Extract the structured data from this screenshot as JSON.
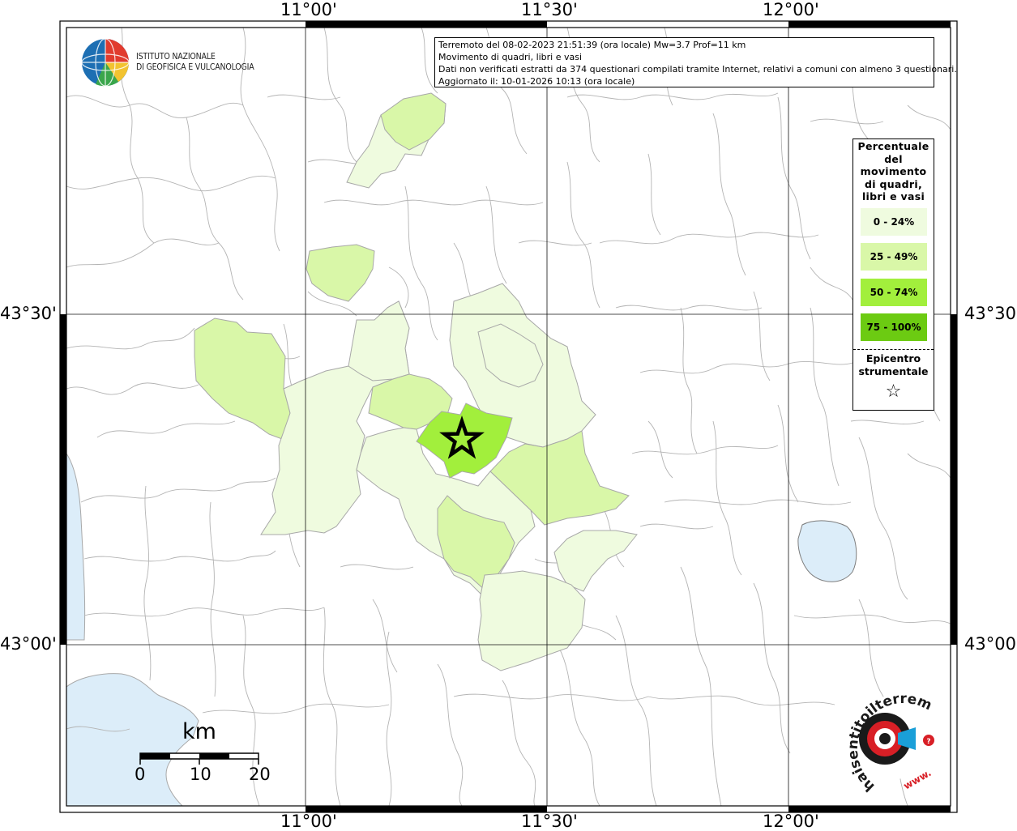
{
  "map": {
    "lon_labels": [
      "11°00'",
      "11°30'",
      "12°00'"
    ],
    "lat_labels": [
      "43°30'",
      "43°00'"
    ]
  },
  "logo": {
    "institute_line1": "ISTITUTO NAZIONALE",
    "institute_line2": "DI GEOFISICA E VULCANOLOGIA"
  },
  "info": {
    "line1": "Terremoto del 08-02-2023 21:51:39 (ora locale) Mw=3.7 Prof=11 km",
    "line2": "Movimento di quadri, libri e vasi",
    "line3": "Dati non verificati estratti da 374 questionari compilati tramite Internet, relativi a comuni con almeno 3 questionari.",
    "line4": "Aggiornato il: 10-01-2026 10:13 (ora locale)"
  },
  "legend": {
    "title_lines": [
      "Percentuale",
      "del",
      "movimento",
      "di quadri,",
      "libri e vasi"
    ],
    "items": [
      {
        "label": "0 - 24%",
        "color": "#effbdf"
      },
      {
        "label": "25 - 49%",
        "color": "#d9f7a8"
      },
      {
        "label": "50 - 74%",
        "color": "#a2ef3c"
      },
      {
        "label": "75 - 100%",
        "color": "#6ccb12"
      }
    ],
    "epicenter_line1": "Epicentro",
    "epicenter_line2": "strumentale",
    "epicenter_symbol": "☆"
  },
  "scale": {
    "unit": "km",
    "labels": [
      "0",
      "10",
      "20"
    ]
  },
  "haisentito": {
    "text": "haisentitoilterremoto.it",
    "www": "www."
  },
  "colors": {
    "water": "#dcedf9",
    "boundary": "#a8a8a8",
    "class_0_24": "#effbdf",
    "class_25_49": "#d9f7a8",
    "class_50_74": "#a2ef3c",
    "brand_red": "#d81f26"
  }
}
